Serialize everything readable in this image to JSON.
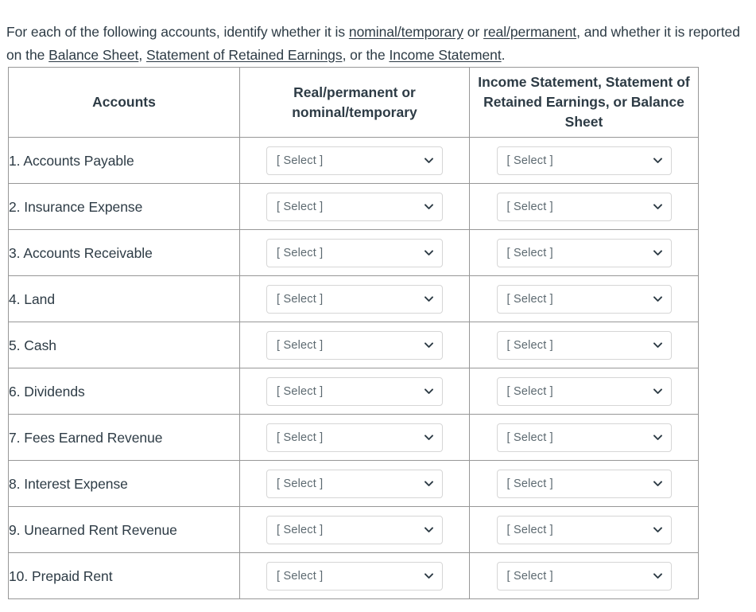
{
  "prompt": {
    "line1_a": "For each of the following accounts, identify whether it is ",
    "term1": "nominal/temporary",
    "line1_b": " or ",
    "term2": "real/permanent",
    "line1_c": ", and whether it is reported on the ",
    "term3": "Balance Sheet",
    "line2_a": ", ",
    "term4": "Statement of Retained Earnings",
    "line2_b": ", or the ",
    "term5": "Income Statement",
    "line2_c": "."
  },
  "table": {
    "headers": {
      "col1": "Accounts",
      "col2_line1": "Real/permanent or",
      "col2_line2": "nominal/temporary",
      "col3_line1": "Income Statement, Statement of",
      "col3_line2": "Retained Earnings, or Balance",
      "col3_line3": "Sheet"
    },
    "select_placeholder": "[ Select ]",
    "rows": [
      {
        "account": "1. Accounts Payable",
        "classification": "[ Select ]",
        "statement": "[ Select ]"
      },
      {
        "account": "2. Insurance Expense",
        "classification": "[ Select ]",
        "statement": "[ Select ]"
      },
      {
        "account": "3. Accounts Receivable",
        "classification": "[ Select ]",
        "statement": "[ Select ]"
      },
      {
        "account": "4. Land",
        "classification": "[ Select ]",
        "statement": "[ Select ]"
      },
      {
        "account": "5. Cash",
        "classification": "[ Select ]",
        "statement": "[ Select ]"
      },
      {
        "account": "6. Dividends",
        "classification": "[ Select ]",
        "statement": "[ Select ]"
      },
      {
        "account": "7. Fees Earned Revenue",
        "classification": "[ Select ]",
        "statement": "[ Select ]"
      },
      {
        "account": "8. Interest Expense",
        "classification": "[ Select ]",
        "statement": "[ Select ]"
      },
      {
        "account": "9. Unearned Rent Revenue",
        "classification": "[ Select ]",
        "statement": "[ Select ]"
      },
      {
        "account": "10. Prepaid Rent",
        "classification": "[ Select ]",
        "statement": "[ Select ]"
      }
    ]
  },
  "colors": {
    "text": "#2d3b45",
    "table_border_outer": "#4a4a4a",
    "table_border_inner": "#979797",
    "select_border": "#d6d6d6",
    "select_text": "#5c6970",
    "background": "#ffffff"
  }
}
